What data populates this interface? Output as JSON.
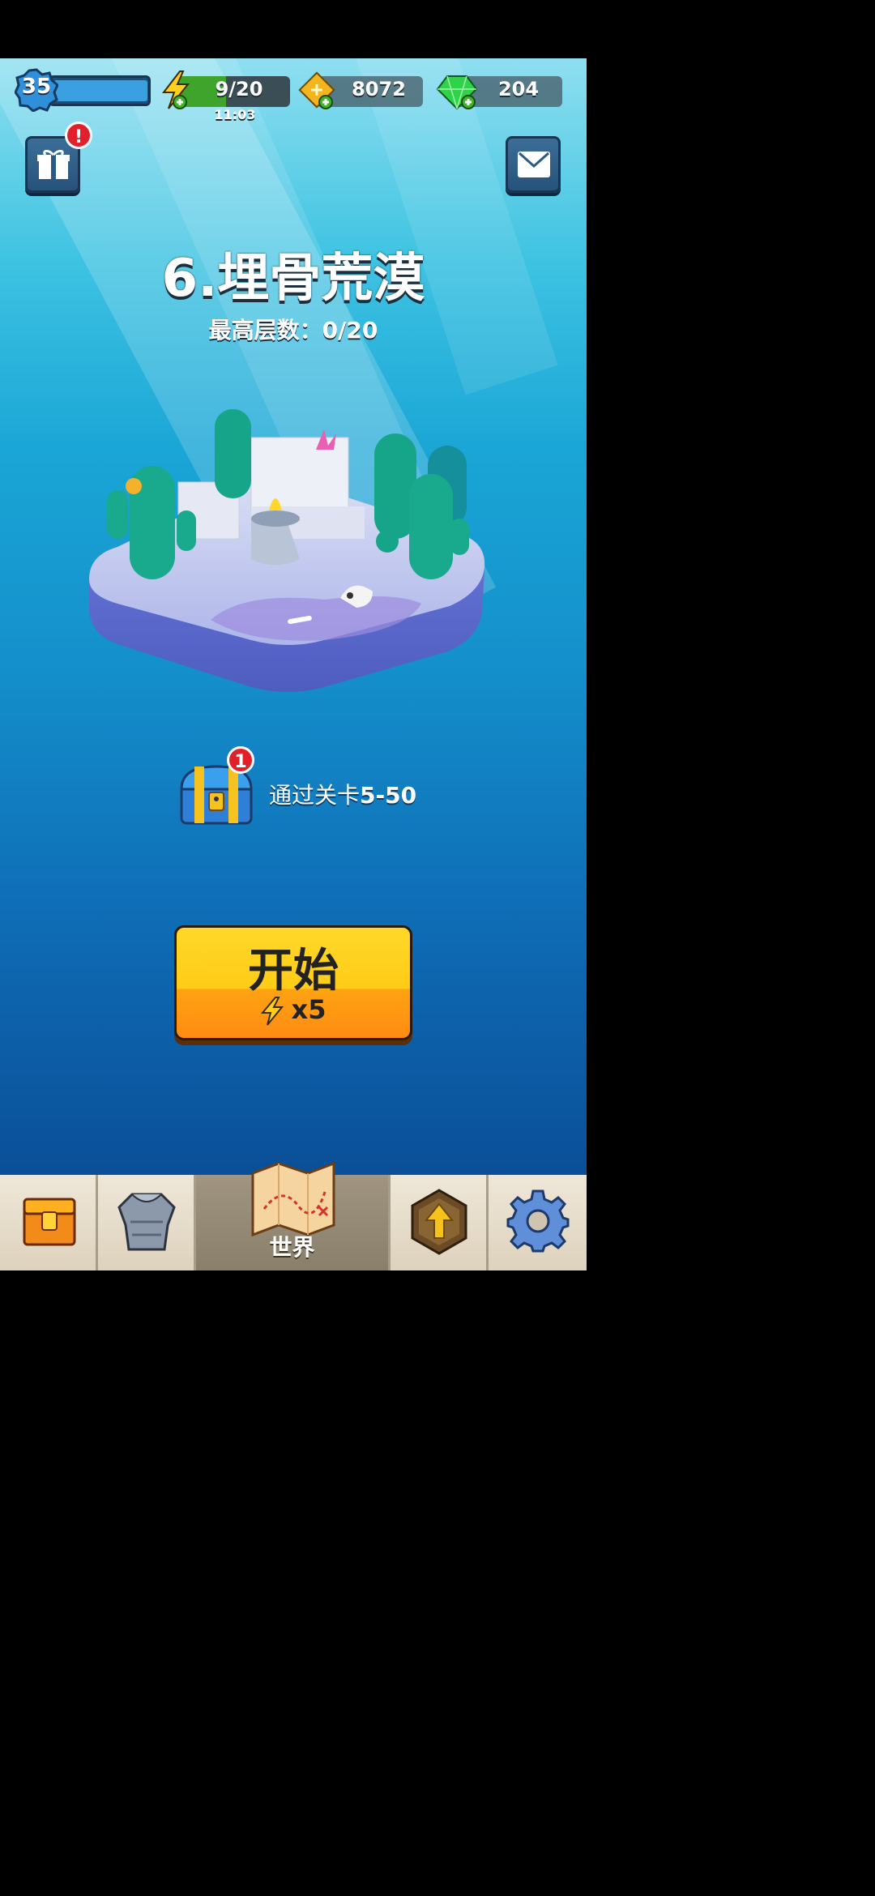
{
  "hud": {
    "level": "35",
    "xp_progress": 0.97,
    "energy": "9/20",
    "energy_progress": 0.45,
    "energy_timer": "11:03",
    "gold": "8072",
    "gems": "204"
  },
  "top_buttons": {
    "gift_alert": "!"
  },
  "stage": {
    "title": "6.埋骨荒漠",
    "best_floor": "最高层数：0/20"
  },
  "reward": {
    "badge_count": "1",
    "text_prefix": "通过关卡",
    "text_level": "5-50"
  },
  "start_button": {
    "label": "开始",
    "cost": "x5"
  },
  "nav": {
    "world_label": "世界"
  },
  "colors": {
    "primary_yellow": "#ffcc17",
    "primary_orange": "#ff8b12",
    "alert_red": "#e0212b",
    "gem_green": "#2fd34a"
  }
}
